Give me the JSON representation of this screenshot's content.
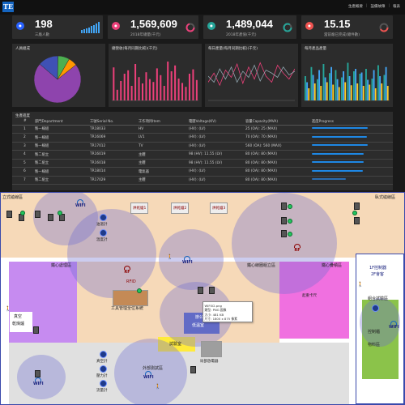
{
  "topbar": {
    "logo": "TE",
    "links": [
      "生產概要",
      "設備故障",
      "報表"
    ]
  },
  "kpis": [
    {
      "value": "198",
      "label": "三廠人數",
      "icon": "user-icon",
      "color": "#2962ff"
    },
    {
      "value": "1,569,609",
      "label": "2018年總量(千元)",
      "icon": "flag-icon",
      "color": "#ec407a"
    },
    {
      "value": "1,489,044",
      "label": "2018年產值(千元)",
      "icon": "chart-icon",
      "color": "#26a69a"
    },
    {
      "value": "15.15",
      "label": "當前廠已完成(總件數)",
      "icon": "box-icon",
      "color": "#ef5350"
    }
  ],
  "panels": [
    {
      "title": "人員組成"
    },
    {
      "title": "總營收(每月同期比較)(千元)"
    },
    {
      "title": "每日產量(每月同期比較)(千元)"
    },
    {
      "title": "每月產品產量"
    }
  ],
  "pie_chart": {
    "type": "pie",
    "slices": [
      {
        "value": 72,
        "color": "#8e44ad"
      },
      {
        "value": 14,
        "color": "#3f51b5"
      },
      {
        "value": 8,
        "color": "#4caf50"
      },
      {
        "value": 6,
        "color": "#ff9800"
      }
    ]
  },
  "chart_data": [
    {
      "type": "bar",
      "values": [
        68,
        22,
        40,
        55,
        62,
        30,
        75,
        48,
        35,
        58,
        44,
        38,
        66,
        52,
        30,
        80,
        60,
        72,
        45,
        36,
        28,
        55,
        64,
        42
      ],
      "color": "#ec407a"
    },
    {
      "type": "line",
      "series": [
        {
          "color": "#ec407a",
          "values": [
            30,
            45,
            25,
            50,
            38,
            60,
            28,
            55,
            35,
            62,
            40,
            30,
            58,
            45,
            35,
            52
          ]
        },
        {
          "color": "#90a4ae",
          "values": [
            40,
            30,
            52,
            35,
            55,
            30,
            48,
            38,
            58,
            32,
            50,
            45,
            38,
            55,
            42,
            48
          ]
        }
      ]
    },
    {
      "type": "bar",
      "series": [
        {
          "color": "#26a69a",
          "values": [
            40,
            55,
            35,
            60,
            45,
            50,
            38,
            62,
            48,
            44,
            52,
            36,
            58,
            42
          ]
        },
        {
          "color": "#42a5f5",
          "values": [
            30,
            42,
            50,
            38,
            55,
            35,
            48,
            40,
            52,
            46,
            34,
            50,
            40,
            55
          ]
        },
        {
          "color": "#ffca28",
          "values": [
            20,
            28,
            24,
            30,
            26,
            22,
            30,
            25,
            28,
            24,
            26,
            20,
            28,
            24
          ]
        }
      ]
    }
  ],
  "table": {
    "title": "生產進度",
    "headers": [
      "#",
      "部門Department",
      "工號Serial No.",
      "工作項目Item",
      "電壓Voltage(KV)",
      "容量Capacity(MVA)",
      "進度Progress"
    ],
    "rows": [
      [
        "1",
        "製一線組",
        "TR18033",
        "HV",
        "(HV): (LV)",
        "25 (OA): 25 (MAX)"
      ],
      [
        "2",
        "製一線組",
        "TR16069",
        "LV1",
        "(HV): (LV)",
        "70 (OA): 70 (MAX)"
      ],
      [
        "3",
        "製一線組",
        "TR17012",
        "TV",
        "(HV): (LV)",
        "560 (OA): 560 (MAX)"
      ],
      [
        "4",
        "製二組立",
        "TR16019",
        "主體",
        "98 (HV): 11.55 (LV)",
        "80 (OA): 80 (MAX)"
      ],
      [
        "5",
        "製二組立",
        "TR16018",
        "主體",
        "98 (HV): 11.55 (LV)",
        "80 (OA): 80 (MAX)"
      ],
      [
        "6",
        "製一線組",
        "TR18014",
        "電氣器",
        "(HV): (LV)",
        "80 (OA): 80 (MAX)"
      ],
      [
        "7",
        "製二組立",
        "TR17029",
        "主體",
        "(HV): (LV)",
        "80 (OA): 80 (MAX)"
      ]
    ],
    "progress": [
      0.98,
      0.97,
      0.98,
      0.92,
      0.92,
      0.9,
      0.6
    ]
  },
  "map": {
    "zones": {
      "vertical_wind": "立式繞線區",
      "horizontal_wind": "臥式繞線區",
      "iron_core": "鐵心處理區",
      "core_assembly": "鐵心線圈組立區",
      "core_hall": "鐵心疊積區",
      "office_tag": "1F控制器",
      "office_tag2": "2F會客",
      "gas_room": "組合試驗區",
      "test_room": "試驗室",
      "rfid": "RFID",
      "dry_area": "工具管理全位系統",
      "office": "辦公室",
      "cold_room": "低溫室",
      "outer_test": "外部測試區",
      "dry_box": "真空",
      "dry_box2": "乾燥爐",
      "gauge_a": "油溫計",
      "gauge_b": "溫度計",
      "gauge_c": "真空計",
      "gauge_d": "壓力計",
      "gauge_e": "流量計",
      "machine_1": "烘乾爐1",
      "machine_2": "烘乾爐2",
      "machine_3": "烘乾爐3",
      "lift": "起重卡尺",
      "analyzer": "局部放電器",
      "control_panel": "控制櫃",
      "material": "物料區",
      "wifi": "WIFI",
      "rf": "RF"
    },
    "tooltip": [
      "WIFI02.png",
      "類型: PNG 圖像",
      "大小: 481 KB",
      "尺寸: 1800 x 875 像素"
    ]
  }
}
